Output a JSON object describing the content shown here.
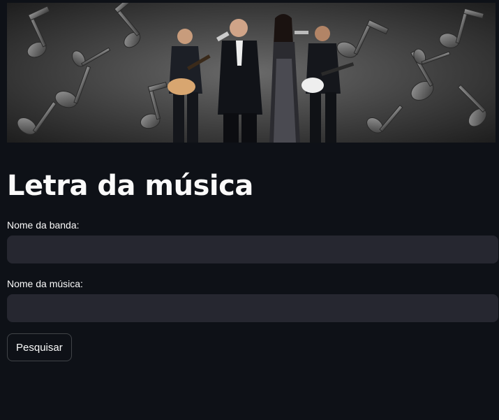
{
  "banner": {
    "image": "band-performing-over-music-notes-photo"
  },
  "page": {
    "title": "Letra da música"
  },
  "form": {
    "band_label": "Nome da banda:",
    "band_value": "",
    "band_placeholder": "",
    "song_label": "Nome da música:",
    "song_value": "",
    "song_placeholder": "",
    "search_button": "Pesquisar"
  },
  "colors": {
    "background": "#0e1117",
    "input_background": "#262730",
    "text": "#fafafa",
    "button_border": "#4a4c55"
  }
}
